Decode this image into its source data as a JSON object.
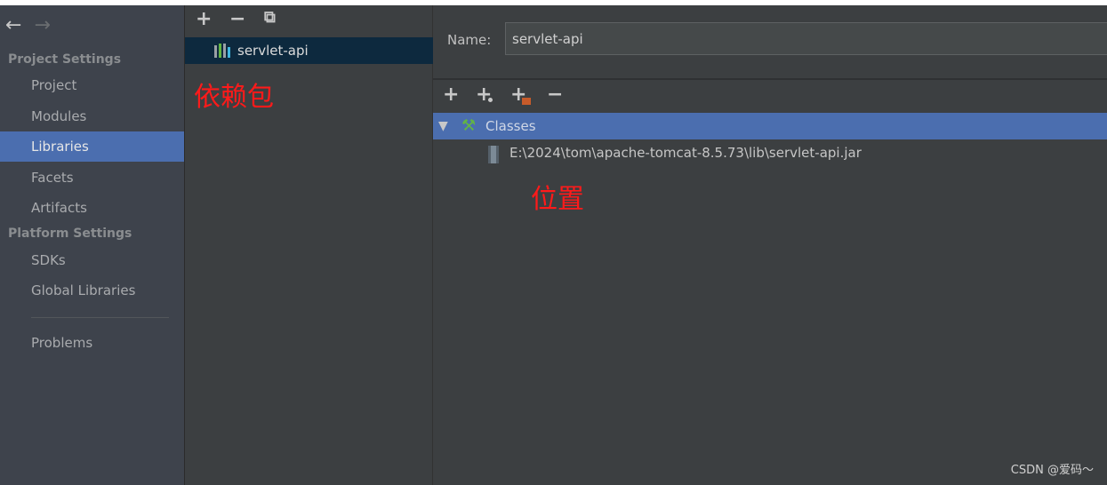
{
  "nav": {
    "back_icon": "arrow-left-icon",
    "forward_icon": "arrow-right-icon"
  },
  "sidebar": {
    "project_settings": "Project Settings",
    "project_items": [
      {
        "label": "Project"
      },
      {
        "label": "Modules"
      },
      {
        "label": "Libraries",
        "selected": true
      },
      {
        "label": "Facets"
      },
      {
        "label": "Artifacts"
      }
    ],
    "platform_settings": "Platform Settings",
    "platform_items": [
      {
        "label": "SDKs"
      },
      {
        "label": "Global Libraries"
      }
    ],
    "problems": "Problems"
  },
  "libraries": {
    "toolbar": [
      "add-icon",
      "remove-icon",
      "copy-icon"
    ],
    "items": [
      {
        "label": "servlet-api",
        "selected": true
      }
    ],
    "annotation": "依赖包"
  },
  "detail": {
    "name_label": "Name:",
    "name_value": "servlet-api",
    "toolbar": [
      "add-icon",
      "add-url-icon",
      "add-folder-icon",
      "remove-icon"
    ],
    "classes_label": "Classes",
    "jar_path": "E:\\2024\\tom\\apache-tomcat-8.5.73\\lib\\servlet-api.jar",
    "annotation": "位置"
  },
  "watermark": "CSDN @爱码～",
  "colors": {
    "selection": "#4b6eaf",
    "list_selection": "#0d293e",
    "annotation": "#ff1a1a"
  }
}
